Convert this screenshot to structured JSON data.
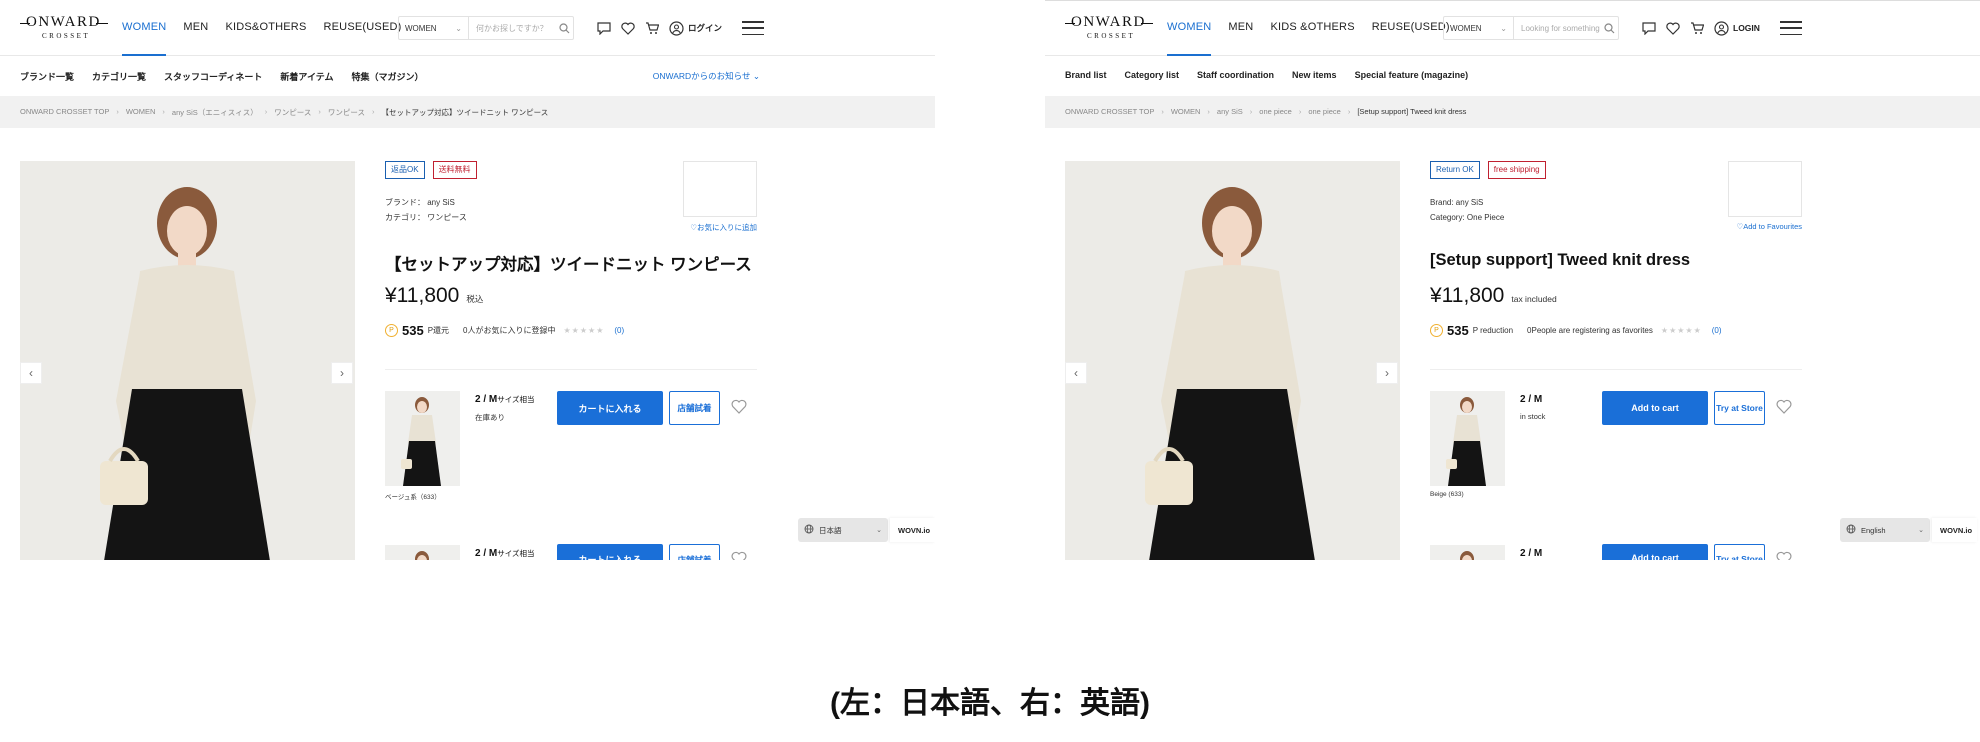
{
  "caption": "(左：日本語、右：英語)",
  "panels": {
    "ja": {
      "logo_main": "ONWARD",
      "logo_sub": "CROSSET",
      "nav": [
        "WOMEN",
        "MEN",
        "KIDS&OTHERS",
        "REUSE(USED)"
      ],
      "search_category": "WOMEN",
      "search_placeholder": "何かお探しですか？",
      "login": "ログイン",
      "subnav": [
        "ブランド一覧",
        "カテゴリ一覧",
        "スタッフコーディネート",
        "新着アイテム",
        "特集（マガジン）"
      ],
      "news": "ONWARDからのお知らせ",
      "breadcrumb": [
        "ONWARD CROSSET TOP",
        "WOMEN",
        "any SiS（エニィスィス）",
        "ワンピース",
        "ワンピース",
        "【セットアップ対応】ツイードニット ワンピース"
      ],
      "badge_return": "返品OK",
      "badge_ship": "送料無料",
      "brand_line": "ブランド： any SiS",
      "category_line": "カテゴリ： ワンピース",
      "fav_link": "♡お気に入りに追加",
      "title": "【セットアップ対応】ツイードニット ワンピース",
      "price": "¥11,800",
      "tax": "税込",
      "points": "535",
      "points_label": "P還元",
      "fav_count_text": "0人がお気に入りに登録中",
      "review_count": "(0)",
      "size": "2 / M",
      "size_note": "サイズ相当",
      "stock": "在庫あり",
      "color": "ベージュ系（633）",
      "cart": "カートに入れる",
      "store": "店舗試着",
      "size2": "2 / M",
      "size2_note": "サイズ相当",
      "lang": "日本語",
      "wovn": "WOVN.io"
    },
    "en": {
      "logo_main": "ONWARD",
      "logo_sub": "CROSSET",
      "nav": [
        "WOMEN",
        "MEN",
        "KIDS &OTHERS",
        "REUSE(USED)"
      ],
      "search_category": "WOMEN",
      "search_placeholder": "Looking for something",
      "login": "LOGIN",
      "subnav": [
        "Brand list",
        "Category list",
        "Staff coordination",
        "New items",
        "Special feature (magazine)"
      ],
      "news": "",
      "breadcrumb": [
        "ONWARD CROSSET TOP",
        "WOMEN",
        "any SiS",
        "one piece",
        "one piece",
        "[Setup support] Tweed knit dress"
      ],
      "badge_return": "Return OK",
      "badge_ship": "free shipping",
      "brand_line": "Brand: any SiS",
      "category_line": "Category: One Piece",
      "fav_link": "♡Add to Favourites",
      "title": "[Setup support] Tweed knit dress",
      "price": "¥11,800",
      "tax": "tax included",
      "points": "535",
      "points_label": "P reduction",
      "fav_count_text": "0People are registering as favorites",
      "review_count": "(0)",
      "size": "2 / M",
      "size_note": "",
      "stock": "in stock",
      "color": "Beige (633)",
      "cart": "Add to cart",
      "store": "Try at Store",
      "size2": "2 / M",
      "size2_note": "",
      "lang": "English",
      "wovn": "WOVN.io"
    }
  },
  "colors": {
    "accent": "#1a6fd8",
    "return_badge": "#1a5fb0",
    "ship_badge": "#c02030",
    "coin": "#f0b030"
  }
}
